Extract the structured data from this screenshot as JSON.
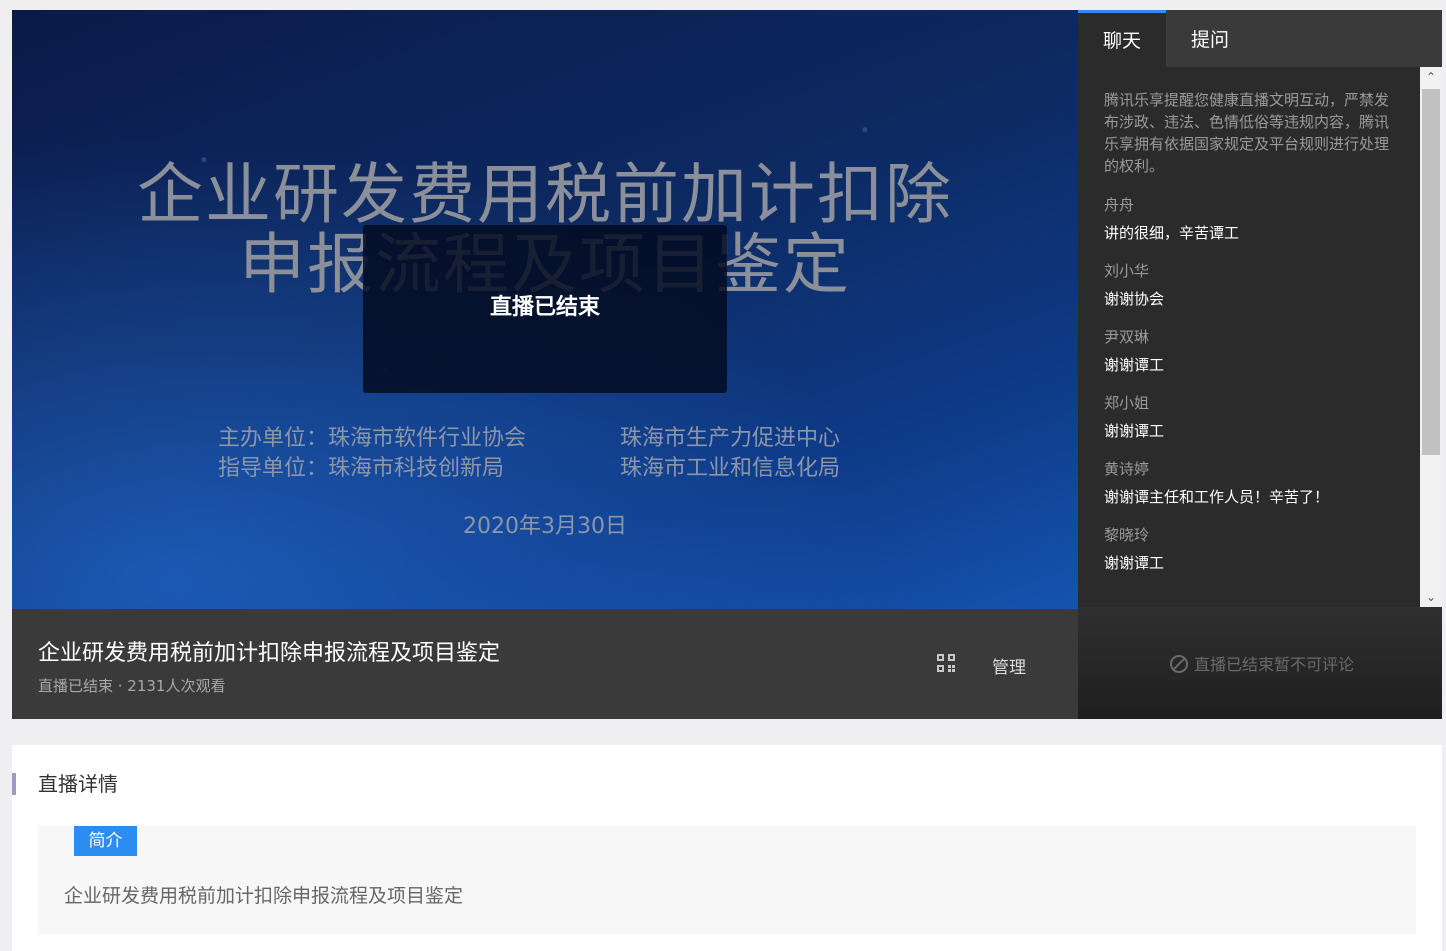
{
  "player": {
    "slide_title_line1": "企业研发费用税前加计扣除",
    "slide_title_line2": "申报流程及项目鉴定",
    "ended_overlay": "直播已结束",
    "host_label": "主办单位：珠海市软件行业协会",
    "host_org2": "珠海市生产力促进中心",
    "guide_label": "指导单位：珠海市科技创新局",
    "guide_org2": "珠海市工业和信息化局",
    "date": "2020年3月30日"
  },
  "info": {
    "title": "企业研发费用税前加计扣除申报流程及项目鉴定",
    "meta": "直播已结束 · 2131人次观看",
    "qr_icon": "qrcode-icon",
    "manage_label": "管理"
  },
  "chat": {
    "tabs": [
      {
        "label": "聊天"
      },
      {
        "label": "提问"
      }
    ],
    "notice": "腾讯乐享提醒您健康直播文明互动，严禁发布涉政、违法、色情低俗等违规内容，腾讯乐享拥有依据国家规定及平台规则进行处理的权利。",
    "messages": [
      {
        "name": "舟舟",
        "text": "讲的很细，辛苦谭工"
      },
      {
        "name": "刘小华",
        "text": "谢谢协会"
      },
      {
        "name": "尹双琳",
        "text": "谢谢谭工"
      },
      {
        "name": "郑小姐",
        "text": "谢谢谭工"
      },
      {
        "name": "黄诗婷",
        "text": "谢谢谭主任和工作人员！辛苦了！"
      },
      {
        "name": "黎晓玲",
        "text": "谢谢谭工"
      }
    ],
    "footer": "直播已结束暂不可评论"
  },
  "details": {
    "heading": "直播详情",
    "tag": "简介",
    "intro": "企业研发费用税前加计扣除申报流程及项目鉴定"
  },
  "colors": {
    "accent": "#2d8cf0",
    "chat_bg": "#2b2b2b",
    "info_bar_bg": "#3a3a3a"
  }
}
